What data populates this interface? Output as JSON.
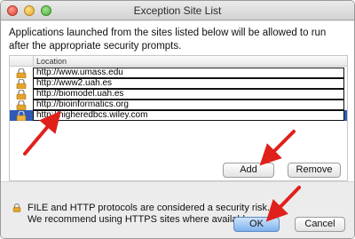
{
  "window": {
    "title": "Exception Site List"
  },
  "intro_text": "Applications launched from the sites listed below will be allowed to run after the appropriate security prompts.",
  "table": {
    "column_header": "Location",
    "rows": [
      {
        "url": "http://www.umass.edu",
        "selected": false
      },
      {
        "url": "http://www2.uah.es",
        "selected": false
      },
      {
        "url": "http://biomodel.uah.es",
        "selected": false
      },
      {
        "url": "http://bioinformatics.org",
        "selected": false
      },
      {
        "url": "http://higheredbcs.wiley.com",
        "selected": true
      }
    ]
  },
  "buttons": {
    "add": "Add",
    "remove": "Remove",
    "ok": "OK",
    "cancel": "Cancel"
  },
  "security_note": {
    "line1": "FILE and HTTP protocols are considered a security risk.",
    "line2": "We recommend using HTTPS sites where available."
  },
  "icons": {
    "lock": "lock-icon",
    "note_lock": "lock-icon",
    "arrows": "red-arrow-icon"
  },
  "colors": {
    "selection": "#2f5bb7",
    "arrow": "#e0201b",
    "ok_button": "#7db2ee"
  }
}
